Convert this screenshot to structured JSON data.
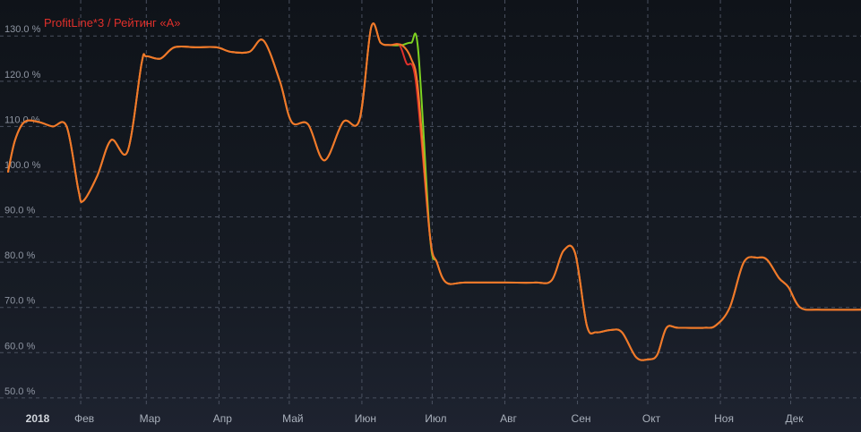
{
  "chart_data": {
    "type": "line",
    "title": "ProfitLine*3 / Рейтинг «А»",
    "xlabel": "",
    "ylabel": "",
    "ylim": [
      48,
      134
    ],
    "y_ticks": [
      50,
      60,
      70,
      80,
      90,
      100,
      110,
      120,
      130
    ],
    "y_tick_labels": [
      "50.0 %",
      "60.0 %",
      "70.0 %",
      "80.0 %",
      "90.0 %",
      "100.0 %",
      "110.0 %",
      "120.0 %",
      "130.0 %"
    ],
    "xlim": [
      "2018-01-01",
      "2018-12-31"
    ],
    "x_ticks": [
      "2018-01-01",
      "2018-02-01",
      "2018-03-01",
      "2018-04-01",
      "2018-05-01",
      "2018-06-01",
      "2018-07-01",
      "2018-08-01",
      "2018-09-01",
      "2018-10-01",
      "2018-11-01",
      "2018-12-01"
    ],
    "x_tick_labels": [
      "2018",
      "Фев",
      "Мар",
      "Апр",
      "Май",
      "Июн",
      "Июл",
      "Авг",
      "Сен",
      "Окт",
      "Ноя",
      "Дек"
    ],
    "grid": true,
    "grid_style": "dashed",
    "series": [
      {
        "color": "#7ed321",
        "points": [
          [
            "2018-01-01",
            100
          ],
          [
            "2018-01-04",
            107
          ],
          [
            "2018-01-08",
            111
          ],
          [
            "2018-01-14",
            111
          ],
          [
            "2018-01-20",
            110
          ],
          [
            "2018-01-26",
            110
          ],
          [
            "2018-01-31",
            96
          ],
          [
            "2018-02-02",
            93.5
          ],
          [
            "2018-02-08",
            99
          ],
          [
            "2018-02-14",
            107
          ],
          [
            "2018-02-21",
            104.5
          ],
          [
            "2018-02-27",
            124
          ],
          [
            "2018-03-01",
            125.5
          ],
          [
            "2018-03-07",
            125
          ],
          [
            "2018-03-13",
            127.5
          ],
          [
            "2018-03-22",
            127.5
          ],
          [
            "2018-03-31",
            127.5
          ],
          [
            "2018-04-06",
            126.5
          ],
          [
            "2018-04-14",
            126.5
          ],
          [
            "2018-04-20",
            129
          ],
          [
            "2018-04-27",
            120
          ],
          [
            "2018-05-02",
            111
          ],
          [
            "2018-05-09",
            110.5
          ],
          [
            "2018-05-16",
            102.5
          ],
          [
            "2018-05-24",
            111
          ],
          [
            "2018-05-31",
            111.5
          ],
          [
            "2018-06-05",
            132
          ],
          [
            "2018-06-09",
            128.5
          ],
          [
            "2018-06-13",
            128
          ],
          [
            "2018-06-18",
            128
          ],
          [
            "2018-06-22",
            128.5
          ],
          [
            "2018-06-25",
            127
          ],
          [
            "2018-06-30",
            86
          ],
          [
            "2018-07-03",
            80
          ],
          [
            "2018-07-07",
            75.5
          ],
          [
            "2018-07-15",
            75.5
          ],
          [
            "2018-08-01",
            75.5
          ],
          [
            "2018-08-14",
            75.5
          ],
          [
            "2018-08-21",
            76
          ],
          [
            "2018-08-26",
            82.5
          ],
          [
            "2018-08-31",
            82
          ],
          [
            "2018-09-05",
            66
          ],
          [
            "2018-09-09",
            64.5
          ],
          [
            "2018-09-15",
            65
          ],
          [
            "2018-09-20",
            64.5
          ],
          [
            "2018-09-26",
            59
          ],
          [
            "2018-10-01",
            58.5
          ],
          [
            "2018-10-05",
            59.5
          ],
          [
            "2018-10-09",
            65.5
          ],
          [
            "2018-10-14",
            65.5
          ],
          [
            "2018-10-25",
            65.5
          ],
          [
            "2018-10-30",
            66
          ],
          [
            "2018-11-05",
            70
          ],
          [
            "2018-11-11",
            80
          ],
          [
            "2018-11-17",
            81
          ],
          [
            "2018-11-21",
            80.5
          ],
          [
            "2018-11-26",
            76.5
          ],
          [
            "2018-11-30",
            74.5
          ],
          [
            "2018-12-05",
            70
          ],
          [
            "2018-12-13",
            69.5
          ],
          [
            "2018-12-31",
            69.5
          ]
        ]
      },
      {
        "color": "#e0302b",
        "points": [
          [
            "2018-01-01",
            100
          ],
          [
            "2018-01-04",
            107
          ],
          [
            "2018-01-08",
            111
          ],
          [
            "2018-01-14",
            111
          ],
          [
            "2018-01-20",
            110
          ],
          [
            "2018-01-26",
            110
          ],
          [
            "2018-01-31",
            96
          ],
          [
            "2018-02-02",
            93.5
          ],
          [
            "2018-02-08",
            99
          ],
          [
            "2018-02-14",
            107
          ],
          [
            "2018-02-21",
            104.5
          ],
          [
            "2018-02-27",
            124
          ],
          [
            "2018-03-01",
            125.5
          ],
          [
            "2018-03-07",
            125
          ],
          [
            "2018-03-13",
            127.5
          ],
          [
            "2018-03-22",
            127.5
          ],
          [
            "2018-03-31",
            127.5
          ],
          [
            "2018-04-06",
            126.5
          ],
          [
            "2018-04-14",
            126.5
          ],
          [
            "2018-04-20",
            129
          ],
          [
            "2018-04-27",
            120
          ],
          [
            "2018-05-02",
            111
          ],
          [
            "2018-05-09",
            110.5
          ],
          [
            "2018-05-16",
            102.5
          ],
          [
            "2018-05-24",
            111
          ],
          [
            "2018-05-31",
            111.5
          ],
          [
            "2018-06-05",
            132
          ],
          [
            "2018-06-09",
            128.5
          ],
          [
            "2018-06-13",
            128
          ],
          [
            "2018-06-17",
            128
          ],
          [
            "2018-06-20",
            124
          ],
          [
            "2018-06-24",
            120
          ],
          [
            "2018-06-30",
            86
          ],
          [
            "2018-07-03",
            80
          ],
          [
            "2018-07-07",
            75.5
          ],
          [
            "2018-07-15",
            75.5
          ],
          [
            "2018-08-01",
            75.5
          ],
          [
            "2018-08-14",
            75.5
          ],
          [
            "2018-08-21",
            76
          ],
          [
            "2018-08-26",
            82.5
          ],
          [
            "2018-08-31",
            82
          ],
          [
            "2018-09-05",
            66
          ],
          [
            "2018-09-09",
            64.5
          ],
          [
            "2018-09-15",
            65
          ],
          [
            "2018-09-20",
            64.5
          ],
          [
            "2018-09-26",
            59
          ],
          [
            "2018-10-01",
            58.5
          ],
          [
            "2018-10-05",
            59.5
          ],
          [
            "2018-10-09",
            65.5
          ],
          [
            "2018-10-14",
            65.5
          ],
          [
            "2018-10-25",
            65.5
          ],
          [
            "2018-10-30",
            66
          ],
          [
            "2018-11-05",
            70
          ],
          [
            "2018-11-11",
            80
          ],
          [
            "2018-11-17",
            81
          ],
          [
            "2018-11-21",
            80.5
          ],
          [
            "2018-11-26",
            76.5
          ],
          [
            "2018-11-30",
            74.5
          ],
          [
            "2018-12-05",
            70
          ],
          [
            "2018-12-13",
            69.5
          ],
          [
            "2018-12-31",
            69.5
          ]
        ]
      },
      {
        "color": "#f07a2a",
        "points": [
          [
            "2018-01-01",
            100
          ],
          [
            "2018-01-04",
            107
          ],
          [
            "2018-01-08",
            111
          ],
          [
            "2018-01-14",
            111
          ],
          [
            "2018-01-20",
            110
          ],
          [
            "2018-01-26",
            110
          ],
          [
            "2018-01-31",
            96
          ],
          [
            "2018-02-02",
            93.5
          ],
          [
            "2018-02-08",
            99
          ],
          [
            "2018-02-14",
            107
          ],
          [
            "2018-02-21",
            104.5
          ],
          [
            "2018-02-27",
            124
          ],
          [
            "2018-03-01",
            125.5
          ],
          [
            "2018-03-07",
            125
          ],
          [
            "2018-03-13",
            127.5
          ],
          [
            "2018-03-22",
            127.5
          ],
          [
            "2018-03-31",
            127.5
          ],
          [
            "2018-04-06",
            126.5
          ],
          [
            "2018-04-14",
            126.5
          ],
          [
            "2018-04-20",
            129
          ],
          [
            "2018-04-27",
            120
          ],
          [
            "2018-05-02",
            111
          ],
          [
            "2018-05-09",
            110.5
          ],
          [
            "2018-05-16",
            102.5
          ],
          [
            "2018-05-24",
            111
          ],
          [
            "2018-05-31",
            111.5
          ],
          [
            "2018-06-05",
            132
          ],
          [
            "2018-06-09",
            128.5
          ],
          [
            "2018-06-13",
            128
          ],
          [
            "2018-06-18",
            128
          ],
          [
            "2018-06-22",
            125
          ],
          [
            "2018-06-25",
            118
          ],
          [
            "2018-06-30",
            86
          ],
          [
            "2018-07-03",
            80
          ],
          [
            "2018-07-07",
            75.5
          ],
          [
            "2018-07-15",
            75.5
          ],
          [
            "2018-08-01",
            75.5
          ],
          [
            "2018-08-14",
            75.5
          ],
          [
            "2018-08-21",
            76
          ],
          [
            "2018-08-26",
            82.5
          ],
          [
            "2018-08-31",
            82
          ],
          [
            "2018-09-05",
            66
          ],
          [
            "2018-09-09",
            64.5
          ],
          [
            "2018-09-15",
            65
          ],
          [
            "2018-09-20",
            64.5
          ],
          [
            "2018-09-26",
            59
          ],
          [
            "2018-10-01",
            58.5
          ],
          [
            "2018-10-05",
            59.5
          ],
          [
            "2018-10-09",
            65.5
          ],
          [
            "2018-10-14",
            65.5
          ],
          [
            "2018-10-25",
            65.5
          ],
          [
            "2018-10-30",
            66
          ],
          [
            "2018-11-05",
            70
          ],
          [
            "2018-11-11",
            80
          ],
          [
            "2018-11-17",
            81
          ],
          [
            "2018-11-21",
            80.5
          ],
          [
            "2018-11-26",
            76.5
          ],
          [
            "2018-11-30",
            74.5
          ],
          [
            "2018-12-05",
            70
          ],
          [
            "2018-12-13",
            69.5
          ],
          [
            "2018-12-31",
            69.5
          ]
        ]
      }
    ],
    "colors": {
      "grid": "#4a5160",
      "tick_text": "#a9b0bb",
      "title": "#e0302b"
    }
  }
}
